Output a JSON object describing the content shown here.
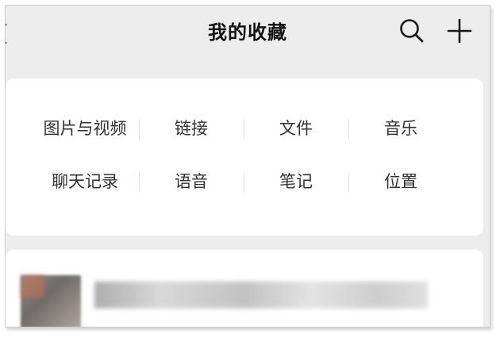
{
  "nav": {
    "title": "我的收藏",
    "back_icon": "chevron-left-icon",
    "search_icon": "search-icon",
    "add_icon": "plus-icon"
  },
  "categories": {
    "row1": [
      "图片与视频",
      "链接",
      "文件",
      "音乐"
    ],
    "row2": [
      "聊天记录",
      "语音",
      "笔记",
      "位置"
    ]
  },
  "colors": {
    "background": "#ededed",
    "card": "#ffffff",
    "text": "#333333",
    "title": "#111111"
  }
}
